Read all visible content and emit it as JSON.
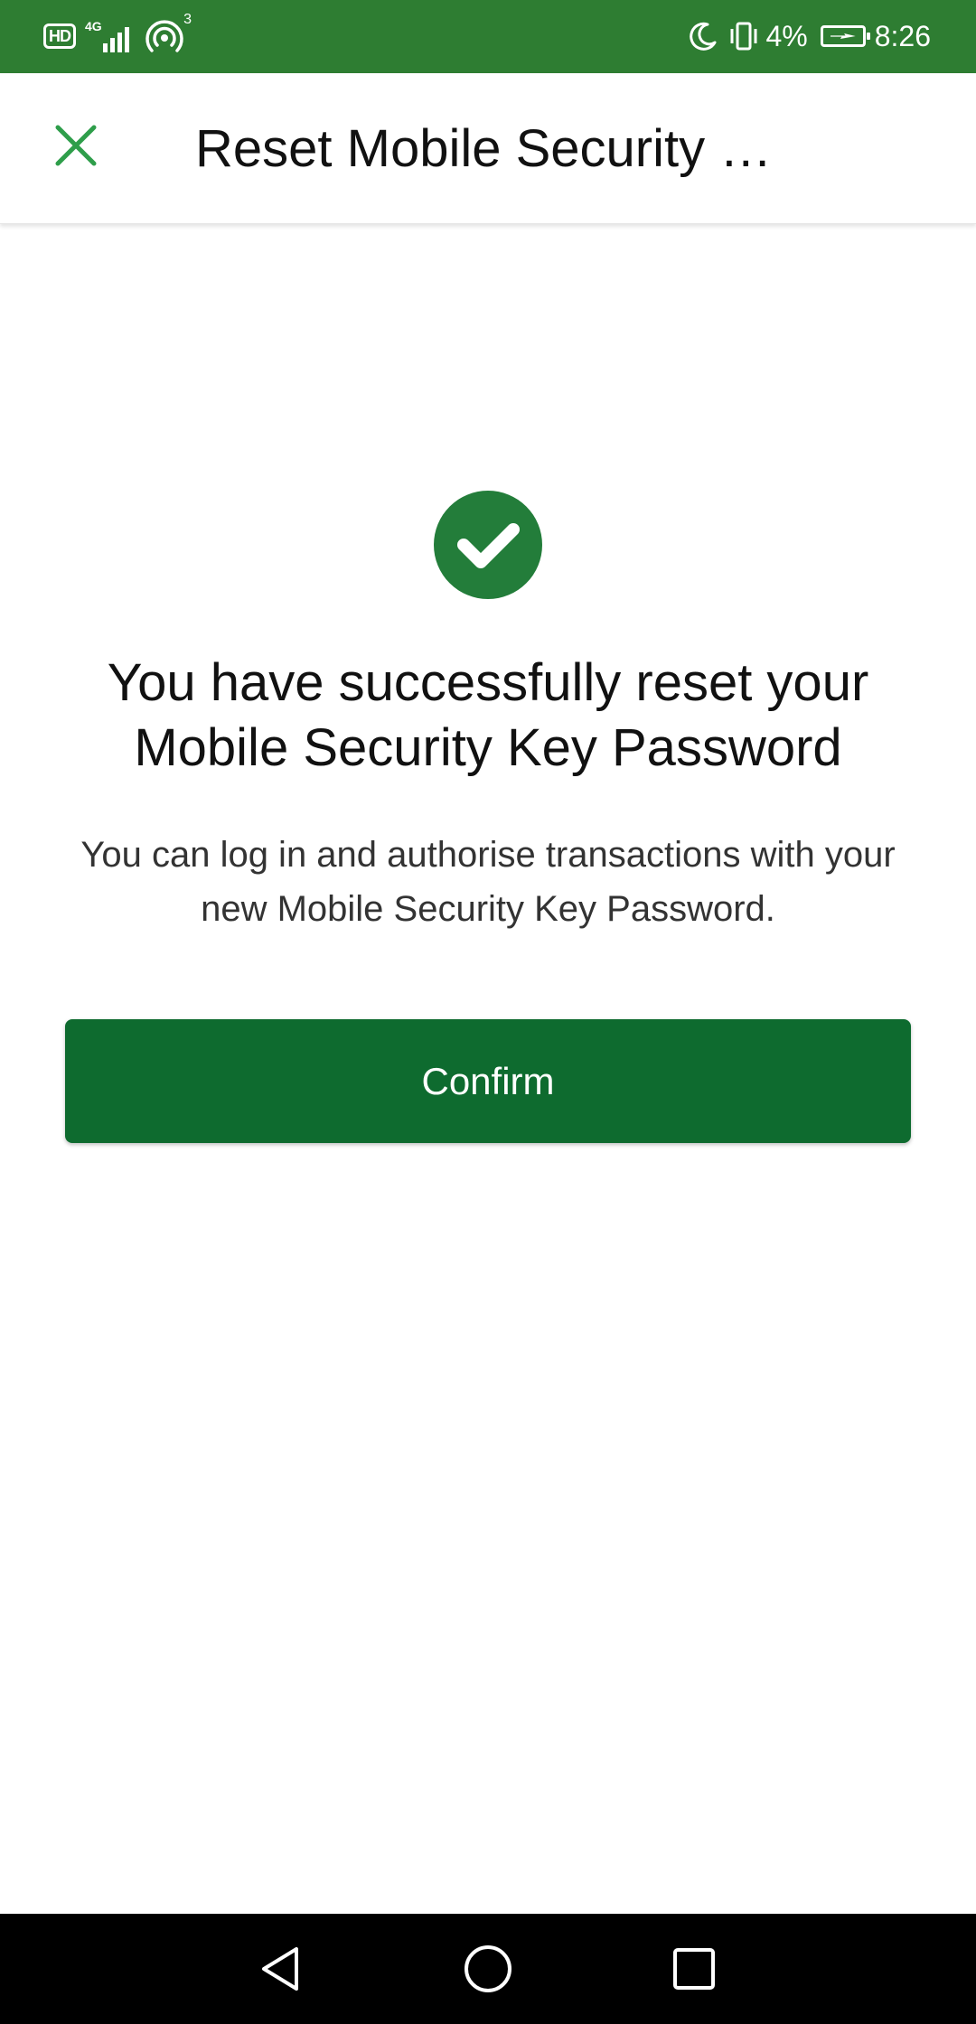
{
  "status_bar": {
    "hd_label": "HD",
    "network_type": "4G",
    "hotspot_count": "3",
    "battery_percent": "4%",
    "time": "8:26",
    "background_color": "#2e7d32"
  },
  "header": {
    "title": "Reset Mobile Security …",
    "close_icon": "close-icon",
    "close_icon_color": "#2e9e4a"
  },
  "main": {
    "success_icon": "check-circle-icon",
    "headline_lines": [
      "You have successfully reset your",
      "Mobile Security Key Password"
    ],
    "description_lines": [
      "You can log in and authorise transactions with your",
      "new Mobile Security Key Password."
    ],
    "confirm_label": "Confirm",
    "accent_color": "#0e6b2f"
  },
  "nav_bar": {
    "back_icon": "back-triangle-icon",
    "home_icon": "home-circle-icon",
    "recents_icon": "recents-square-icon"
  }
}
